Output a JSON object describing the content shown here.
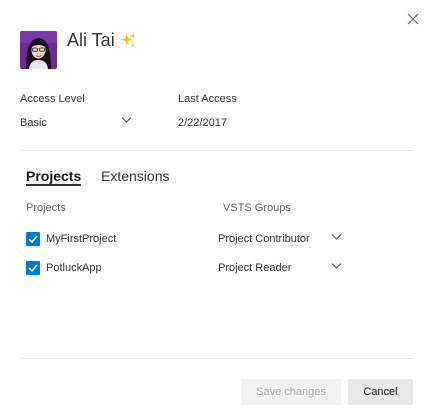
{
  "user": {
    "name": "Ali Tai"
  },
  "access": {
    "label": "Access Level",
    "value": "Basic"
  },
  "last_access": {
    "label": "Last Access",
    "value": "2/22/2017"
  },
  "tabs": [
    {
      "label": "Projects",
      "active": true
    },
    {
      "label": "Extensions",
      "active": false
    }
  ],
  "table": {
    "headers": {
      "projects": "Projects",
      "groups": "VSTS Groups"
    },
    "rows": [
      {
        "project": "MyFirstProject",
        "checked": true,
        "group": "Project Contributor"
      },
      {
        "project": "PotluckApp",
        "checked": true,
        "group": "Project Reader"
      }
    ]
  },
  "footer": {
    "save_label": "Save changes",
    "cancel_label": "Cancel"
  },
  "colors": {
    "accent": "#0078d4",
    "divider": "#e6e6e6",
    "sparkle": "#f5c400"
  },
  "icons": {
    "close": "close-icon",
    "sparkle": "sparkle-icon",
    "chevron": "chevron-down-icon",
    "check": "checkmark-icon"
  }
}
